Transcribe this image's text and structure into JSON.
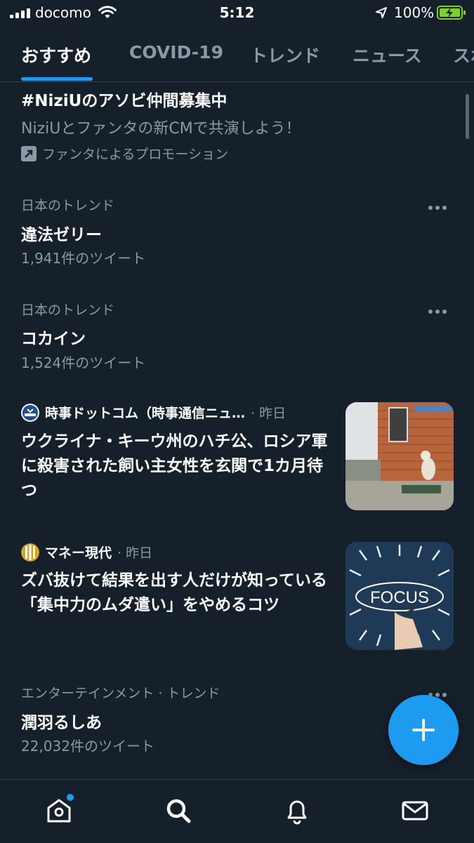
{
  "status_bar": {
    "carrier": "docomo",
    "time": "5:12",
    "battery": "100%"
  },
  "tabs": [
    {
      "label": "おすすめ",
      "active": true
    },
    {
      "label": "COVID-19",
      "active": false
    },
    {
      "label": "トレンド",
      "active": false
    },
    {
      "label": "ニュース",
      "active": false
    },
    {
      "label": "スポ",
      "active": false
    }
  ],
  "promoted": {
    "title": "#NiziUのアソビ仲間募集中",
    "description": "NiziUとファンタの新CMで共演しよう！",
    "badge": "ファンタによるプロモーション"
  },
  "trends": [
    {
      "context": "日本のトレンド",
      "title": "違法ゼリー",
      "count": "1,941件のツイート"
    },
    {
      "context": "日本のトレンド",
      "title": "コカイン",
      "count": "1,524件のツイート"
    },
    {
      "context": "エンターテインメント · トレンド",
      "title": "潤羽るしあ",
      "count": "22,032件のツイート"
    }
  ],
  "news": [
    {
      "source": "時事ドットコム（時事通信ニュ…",
      "time": "· 昨日",
      "title": "ウクライナ・キーウ州のハチ公、ロシア軍に殺害された飼い主女性を玄関で1カ月待つ",
      "logo_icon": "jiji-logo-icon",
      "thumb": "dog-at-door-photo"
    },
    {
      "source": "マネー現代",
      "time": "· 昨日",
      "title": "ズバ抜けて結果を出す人だけが知っている「集中力のムダ遣い」をやめるコツ",
      "logo_icon": "money-gendai-logo-icon",
      "thumb_text": "FOCUS"
    }
  ],
  "bottom_nav": [
    {
      "icon": "home-icon",
      "has_badge": true
    },
    {
      "icon": "search-icon",
      "active": true
    },
    {
      "icon": "bell-icon"
    },
    {
      "icon": "mail-icon"
    }
  ],
  "colors": {
    "background": "#15202b",
    "accent": "#1d9bf0",
    "secondary_text": "#8b98a5",
    "divider": "#38444d"
  }
}
